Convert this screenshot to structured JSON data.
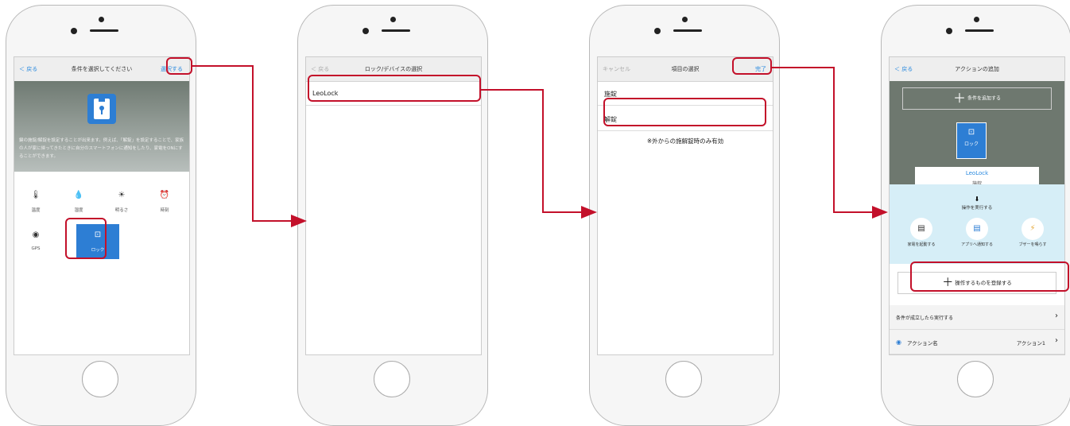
{
  "screen1": {
    "nav": {
      "back": "＜ 戻る",
      "title": "条件を選択してください",
      "action": "選択する"
    },
    "description": "鍵の施錠/解錠を設定することが出来ます。例えば、「解錠」を設定することで、家族の人が家に帰ってきたときに自分のスマートフォンに通知をしたり、家電をONにすることができます。",
    "conditions": [
      {
        "label": "温度",
        "icon": "thermometer-icon"
      },
      {
        "label": "湿度",
        "icon": "drop-icon"
      },
      {
        "label": "明るさ",
        "icon": "light-icon"
      },
      {
        "label": "時刻",
        "icon": "clock-icon"
      },
      {
        "label": "GPS",
        "icon": "gps-icon"
      },
      {
        "label": "ロック",
        "icon": "lock-icon"
      }
    ]
  },
  "screen2": {
    "nav": {
      "back": "＜ 戻る",
      "title": "ロック/デバイスの選択"
    },
    "items": [
      "LeoLock"
    ]
  },
  "screen3": {
    "nav": {
      "back": "キャンセル",
      "title": "項目の選択",
      "action": "完了"
    },
    "items": [
      "施錠",
      "解錠"
    ],
    "note": "※外からの施解錠時のみ有効"
  },
  "screen4": {
    "nav": {
      "back": "＜ 戻る",
      "title": "アクションの追加"
    },
    "add_condition": "条件を追加する",
    "lock_label": "ロック",
    "device_name": "LeoLock",
    "device_state": "施錠",
    "execute_label": "操作を実行する",
    "actions": [
      "家電を起動する",
      "アプリへ通知する",
      "ブザーを鳴らす"
    ],
    "register_label": "操作するものを登録する",
    "row1": "条件が成立したら実行する",
    "row2_label": "アクション名",
    "row2_value": "アクション1"
  }
}
